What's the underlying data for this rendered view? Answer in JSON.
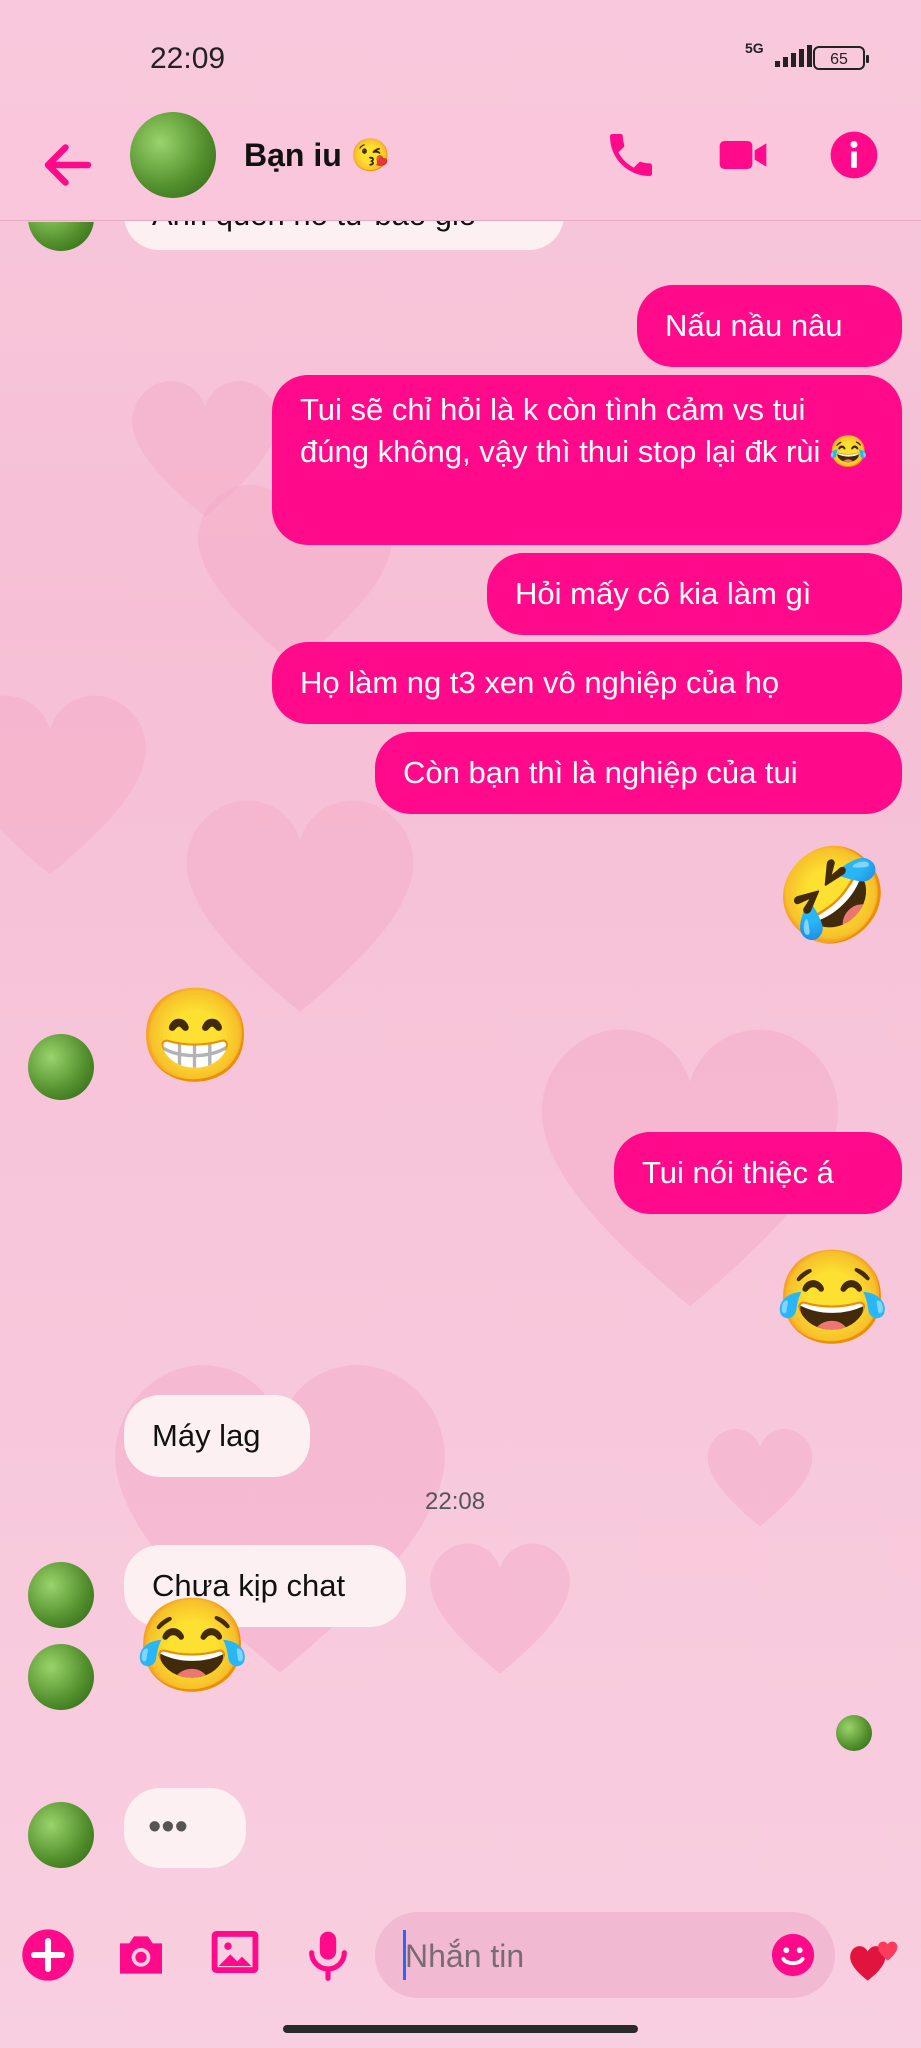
{
  "status_bar": {
    "time": "22:09",
    "network": "5G",
    "battery": "65"
  },
  "header": {
    "contact_name": "Bạn iu 😘"
  },
  "messages": [
    {
      "id": "m0",
      "text": "Anh quên nó từ bao giờ"
    },
    {
      "id": "m1",
      "text": "Nấu nầu nâu"
    },
    {
      "id": "m2",
      "text": "Tui sẽ chỉ hỏi là k còn tình cảm vs tui đúng không, vậy thì thui stop lại đk rùi 😂"
    },
    {
      "id": "m3",
      "text": "Hỏi mấy cô kia làm gì"
    },
    {
      "id": "m4",
      "text": "Họ làm ng t3 xen vô nghiệp của họ"
    },
    {
      "id": "m5",
      "text": "Còn bạn thì là nghiệp của tui"
    },
    {
      "id": "m6",
      "text": "🤣"
    },
    {
      "id": "m7",
      "text": "😁"
    },
    {
      "id": "m8",
      "text": "Tui nói thiệc á"
    },
    {
      "id": "m9",
      "text": "😂"
    },
    {
      "id": "m10",
      "text": "Máy lag"
    },
    {
      "id": "m11",
      "text": "Chưa kịp chat"
    },
    {
      "id": "m12",
      "text": "😂"
    },
    {
      "id": "m13",
      "text": "•••"
    }
  ],
  "timestamp": "22:08",
  "composer": {
    "placeholder": "Nhắn tin"
  },
  "icons": [
    "back-arrow-icon",
    "phone-icon",
    "video-camera-icon",
    "info-icon",
    "plus-icon",
    "camera-icon",
    "image-icon",
    "microphone-icon",
    "emoji-icon",
    "heart-icon"
  ],
  "colors": {
    "accent": "#ff0a8a",
    "header_bg": "#f9c6dc",
    "incoming_bubble": "#fdf0f3"
  }
}
